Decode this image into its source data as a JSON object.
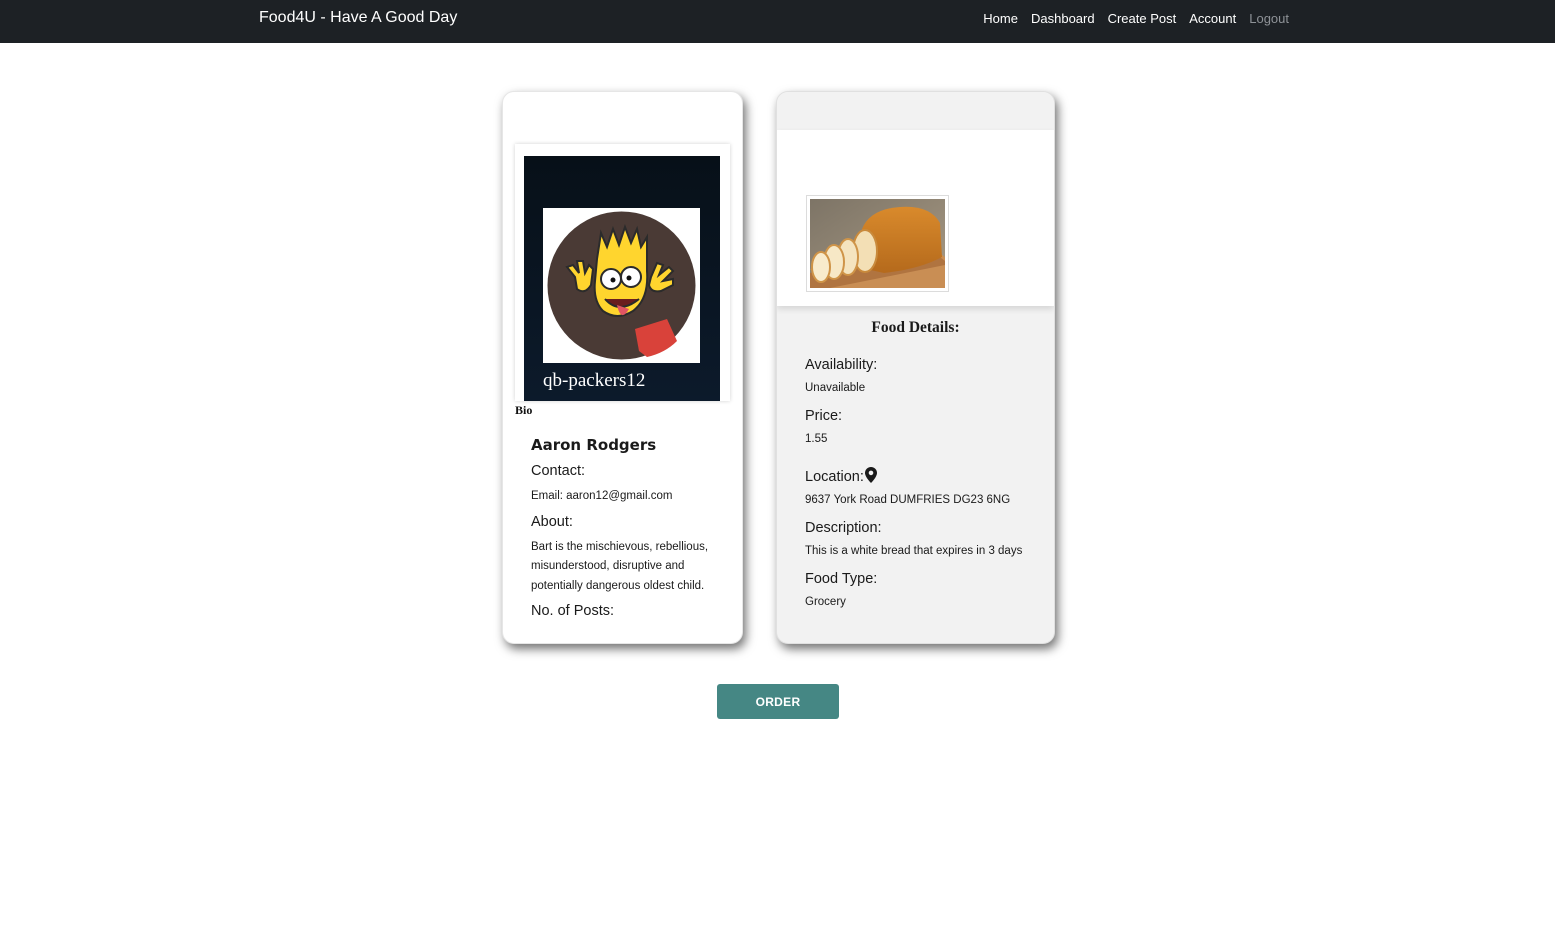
{
  "navbar": {
    "brand": "Food4U - Have A Good Day",
    "links": [
      "Home",
      "Dashboard",
      "Create Post",
      "Account",
      "Logout"
    ]
  },
  "profile": {
    "username": "qb-packers12",
    "bio_label": "Bio",
    "name": "Aaron Rodgers",
    "contact_label": "Contact:",
    "email": "Email: aaron12@gmail.com",
    "about_label": "About:",
    "about_text": "Bart is the mischievous, rebellious, misunderstood, disruptive and potentially dangerous oldest child.",
    "posts_label": "No. of Posts:",
    "avatar_icon": "cartoon-avatar-image"
  },
  "food": {
    "image_icon": "bread-loaf-image",
    "details_title": "Food Details:",
    "availability_label": "Availability:",
    "availability": "Unavailable",
    "price_label": "Price:",
    "price": "1.55",
    "location_label": "Location:",
    "location_icon": "map-pin-icon",
    "location": "9637 York Road DUMFRIES DG23 6NG",
    "description_label": "Description:",
    "description": "This is a white bread that expires in 3 days",
    "type_label": "Food Type:",
    "type": "Grocery"
  },
  "order_button": "ORDER",
  "colors": {
    "navbar_bg": "#1d2125",
    "order_button": "#458784",
    "food_card_bg": "#f2f2f2"
  }
}
